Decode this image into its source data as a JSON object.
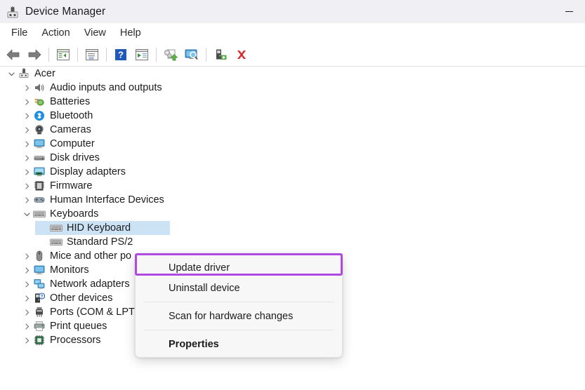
{
  "window": {
    "title": "Device Manager",
    "icon": "device-manager-icon",
    "controls": [
      {
        "name": "minimize-button",
        "glyph": "minimize"
      }
    ]
  },
  "menubar": {
    "items": [
      {
        "label": "File"
      },
      {
        "label": "Action"
      },
      {
        "label": "View"
      },
      {
        "label": "Help"
      }
    ]
  },
  "toolbar": {
    "buttons": [
      {
        "name": "back-button",
        "icon": "back-arrow-icon"
      },
      {
        "name": "forward-button",
        "icon": "forward-arrow-icon"
      },
      {
        "name": "separator-1",
        "icon": "separator"
      },
      {
        "name": "show-hide-console-tree-button",
        "icon": "console-tree-icon"
      },
      {
        "name": "separator-2",
        "icon": "separator"
      },
      {
        "name": "properties-button",
        "icon": "properties-window-icon"
      },
      {
        "name": "separator-3",
        "icon": "separator"
      },
      {
        "name": "help-button",
        "icon": "help-question-icon"
      },
      {
        "name": "action-menu-button",
        "icon": "action-play-icon"
      },
      {
        "name": "separator-4",
        "icon": "separator"
      },
      {
        "name": "update-driver-button",
        "icon": "update-driver-icon"
      },
      {
        "name": "scan-hardware-changes-button",
        "icon": "scan-monitor-icon"
      },
      {
        "name": "separator-5",
        "icon": "separator"
      },
      {
        "name": "add-legacy-hardware-button",
        "icon": "add-device-icon"
      },
      {
        "name": "uninstall-device-button",
        "icon": "red-x-icon"
      }
    ]
  },
  "tree": {
    "root": {
      "label": "Acer",
      "icon": "computer-root-icon",
      "expanded": true
    },
    "items": [
      {
        "label": "Audio inputs and outputs",
        "icon": "speaker-icon",
        "indent": 1,
        "expandable": true,
        "expanded": false,
        "selected": false
      },
      {
        "label": "Batteries",
        "icon": "battery-plug-icon",
        "indent": 1,
        "expandable": true,
        "expanded": false,
        "selected": false
      },
      {
        "label": "Bluetooth",
        "icon": "bluetooth-icon",
        "indent": 1,
        "expandable": true,
        "expanded": false,
        "selected": false
      },
      {
        "label": "Cameras",
        "icon": "camera-icon",
        "indent": 1,
        "expandable": true,
        "expanded": false,
        "selected": false
      },
      {
        "label": "Computer",
        "icon": "monitor-icon",
        "indent": 1,
        "expandable": true,
        "expanded": false,
        "selected": false
      },
      {
        "label": "Disk drives",
        "icon": "disk-drive-icon",
        "indent": 1,
        "expandable": true,
        "expanded": false,
        "selected": false
      },
      {
        "label": "Display adapters",
        "icon": "display-adapter-icon",
        "indent": 1,
        "expandable": true,
        "expanded": false,
        "selected": false
      },
      {
        "label": "Firmware",
        "icon": "firmware-chip-icon",
        "indent": 1,
        "expandable": true,
        "expanded": false,
        "selected": false
      },
      {
        "label": "Human Interface Devices",
        "icon": "hid-gamepad-icon",
        "indent": 1,
        "expandable": true,
        "expanded": false,
        "selected": false
      },
      {
        "label": "Keyboards",
        "icon": "keyboard-icon",
        "indent": 1,
        "expandable": true,
        "expanded": true,
        "selected": false
      },
      {
        "label": "HID Keyboard",
        "icon": "keyboard-icon",
        "indent": 2,
        "expandable": false,
        "expanded": false,
        "selected": true
      },
      {
        "label": "Standard PS/2",
        "icon": "keyboard-icon",
        "indent": 2,
        "expandable": false,
        "expanded": false,
        "selected": false
      },
      {
        "label": "Mice and other po",
        "icon": "mouse-icon",
        "indent": 1,
        "expandable": true,
        "expanded": false,
        "selected": false
      },
      {
        "label": "Monitors",
        "icon": "monitor-icon",
        "indent": 1,
        "expandable": true,
        "expanded": false,
        "selected": false
      },
      {
        "label": "Network adapters",
        "icon": "network-icon",
        "indent": 1,
        "expandable": true,
        "expanded": false,
        "selected": false
      },
      {
        "label": "Other devices",
        "icon": "unknown-device-icon",
        "indent": 1,
        "expandable": true,
        "expanded": false,
        "selected": false
      },
      {
        "label": "Ports (COM & LPT)",
        "icon": "port-icon",
        "indent": 1,
        "expandable": true,
        "expanded": false,
        "selected": false
      },
      {
        "label": "Print queues",
        "icon": "printer-icon",
        "indent": 1,
        "expandable": true,
        "expanded": false,
        "selected": false
      },
      {
        "label": "Processors",
        "icon": "processor-icon",
        "indent": 1,
        "expandable": true,
        "expanded": false,
        "selected": false
      }
    ]
  },
  "context_menu": {
    "items": [
      {
        "label": "Update driver",
        "bold": false,
        "highlighted": true
      },
      {
        "label": "Uninstall device",
        "bold": false,
        "highlighted": false
      },
      {
        "separator": true
      },
      {
        "label": "Scan for hardware changes",
        "bold": false,
        "highlighted": false
      },
      {
        "separator": true
      },
      {
        "label": "Properties",
        "bold": true,
        "highlighted": false
      }
    ]
  },
  "annotation": {
    "highlight_color": "#b14ae0",
    "target": "Update driver"
  },
  "colors": {
    "selection": "#cce3f5",
    "titlebar": "#f0f0f4",
    "menu_bg": "#f7f7f7",
    "text": "#1b1b1b"
  }
}
